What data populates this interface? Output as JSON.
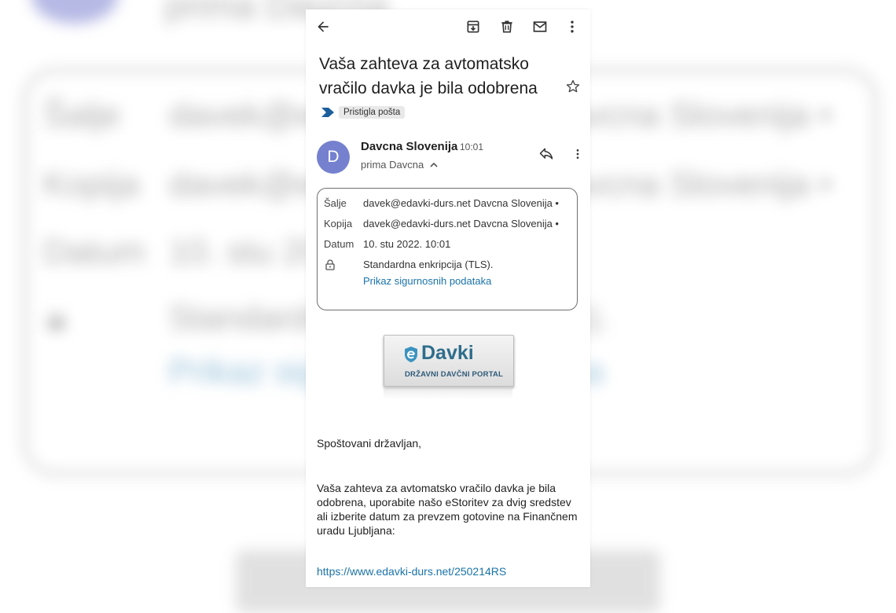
{
  "email": {
    "subject": "Vaša zahteva za avtomatsko vračilo davka je bila odobrena",
    "label": "Pristigla pošta",
    "sender": {
      "initial": "D",
      "name": "Davcna Slovenija",
      "time": "10:01",
      "recipient": "prima Davcna"
    },
    "details": {
      "from_key": "Šalje",
      "from_value": "davek@edavki-durs.net Davcna Slovenija •",
      "cc_key": "Kopija",
      "cc_value": "davek@edavki-durs.net Davcna Slovenija •",
      "date_key": "Datum",
      "date_value": "10. stu 2022. 10:01",
      "security_value": "Standardna enkripcija (TLS).",
      "security_link": "Prikaz sigurnosnih podataka"
    },
    "logo": {
      "word": "Davki",
      "subtitle": "DRŽAVNI DAVČNI PORTAL"
    },
    "greeting": "Spoštovani državljan,",
    "paragraph": "Vaša zahteva za avtomatsko vračilo davka je bila odobrena, uporabite našo eStoritev za dvig sredstev ali izberite datum za prevzem gotovine na Finančnem uradu Ljubljana:",
    "link": "https://www.edavki-durs.net/250214RS"
  },
  "icons": [
    "back-arrow-icon",
    "archive-icon",
    "delete-icon",
    "mail-icon",
    "more-vert-icon",
    "star-icon",
    "label-arrow-icon",
    "reply-icon",
    "lock-icon",
    "chevron-up-icon"
  ],
  "colors": {
    "avatar": "#7581cf",
    "link": "#1a73a8",
    "logo_text": "#2e6d8c"
  },
  "background": {
    "top_word": "prima Davcna",
    "row1_key": "Šalje",
    "row1_val": "davek@edavki-durs.net Davcna Slovenija •",
    "row2_key": "Kopija",
    "row2_val": "davek@edavki-durs.net Davcna Slovenija •",
    "row3_key": "Datum",
    "row3_val": "10. stu 2022. 10:01",
    "row4_val": "Standardna enkripcija (TLS).",
    "row5_val": "Prikaz sigurnosnih podataka"
  }
}
